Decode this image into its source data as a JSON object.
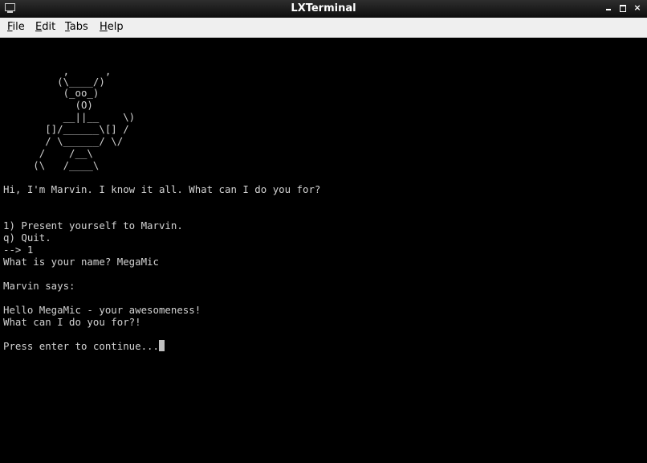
{
  "window": {
    "title": "LXTerminal",
    "controls": {
      "minimize": "minimize",
      "maximize": "maximize",
      "close": "×"
    }
  },
  "menubar": {
    "file": {
      "mnemonic": "F",
      "rest": "ile"
    },
    "edit": {
      "mnemonic": "E",
      "rest": "dit"
    },
    "tabs": {
      "mnemonic": "T",
      "rest": "abs"
    },
    "help": {
      "mnemonic": "H",
      "rest": "elp"
    }
  },
  "terminal": {
    "ascii_art": [
      "          ,      ,",
      "         (\\____/)",
      "          (_oo_)",
      "            (O)",
      "          __||__    \\)",
      "       []/______\\[] /",
      "       / \\______/ \\/",
      "      /    /__\\",
      "     (\\   /____\\"
    ],
    "greeting": "Hi, I'm Marvin. I know it all. What can I do you for?",
    "option_1": "1) Present yourself to Marvin.",
    "option_q": "q) Quit.",
    "prompt_input": "--> 1",
    "name_prompt": "What is your name? MegaMic",
    "marvin_says": "Marvin says:",
    "hello_line": "Hello MegaMic - your awesomeness!",
    "question_line": "What can I do you for?!",
    "continue_prompt": "Press enter to continue..."
  },
  "icons": {
    "app": "terminal-icon",
    "minimize": "minimize-icon",
    "maximize": "maximize-icon",
    "close": "close-icon"
  },
  "colors": {
    "terminal_background": "#000000",
    "terminal_text": "#d3d3d3",
    "titlebar": "#1a1a1a",
    "menubar": "#efefef"
  }
}
